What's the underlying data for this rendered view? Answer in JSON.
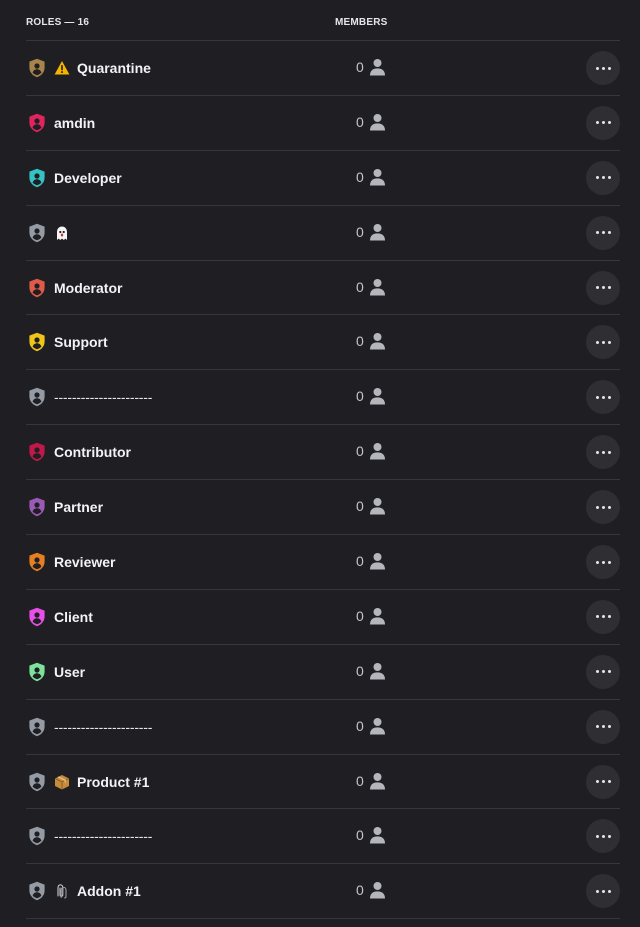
{
  "header": {
    "roles_label": "ROLES — 16",
    "members_label": "MEMBERS"
  },
  "roles": [
    {
      "name": "Quarantine",
      "emoji": "warning-icon",
      "color": "#a8834a",
      "members": "0"
    },
    {
      "name": "amdin",
      "emoji": "",
      "color": "#e0245e",
      "members": "0"
    },
    {
      "name": "Developer",
      "emoji": "",
      "color": "#35c2c2",
      "members": "0"
    },
    {
      "name": "",
      "emoji": "ghost-icon",
      "color": "#949ba4",
      "members": "0"
    },
    {
      "name": "Moderator",
      "emoji": "",
      "color": "#e05a4a",
      "members": "0"
    },
    {
      "name": "Support",
      "emoji": "",
      "color": "#f0c419",
      "members": "0"
    },
    {
      "name": "----------------------",
      "emoji": "",
      "color": "#949ba4",
      "members": "0",
      "dashes": true
    },
    {
      "name": "Contributor",
      "emoji": "",
      "color": "#c0184a",
      "members": "0"
    },
    {
      "name": "Partner",
      "emoji": "",
      "color": "#9b59b6",
      "members": "0"
    },
    {
      "name": "Reviewer",
      "emoji": "",
      "color": "#e67e22",
      "members": "0"
    },
    {
      "name": "Client",
      "emoji": "",
      "color": "#e84fe8",
      "members": "0"
    },
    {
      "name": "User",
      "emoji": "",
      "color": "#7ee29a",
      "members": "0"
    },
    {
      "name": "----------------------",
      "emoji": "",
      "color": "#949ba4",
      "members": "0",
      "dashes": true
    },
    {
      "name": "Product #1",
      "emoji": "package-icon",
      "color": "#949ba4",
      "members": "0"
    },
    {
      "name": "----------------------",
      "emoji": "",
      "color": "#949ba4",
      "members": "0",
      "dashes": true
    },
    {
      "name": "Addon #1",
      "emoji": "paperclips-icon",
      "color": "#949ba4",
      "members": "0"
    }
  ]
}
